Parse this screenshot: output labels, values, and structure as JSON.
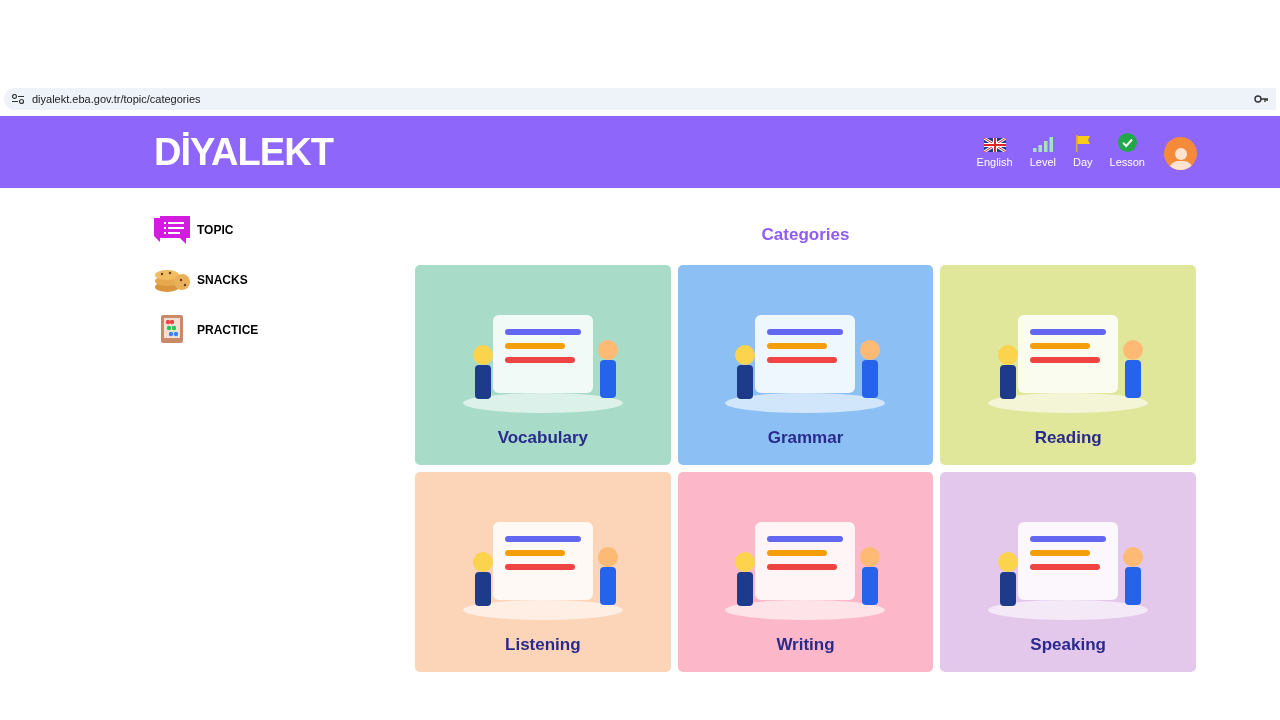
{
  "address_bar": {
    "url": "diyalekt.eba.gov.tr/topic/categories"
  },
  "header": {
    "logo": "DİYALEKT",
    "stats": [
      {
        "kind": "language",
        "label": "English"
      },
      {
        "kind": "level",
        "label": "Level"
      },
      {
        "kind": "day",
        "label": "Day"
      },
      {
        "kind": "lesson",
        "label": "Lesson"
      }
    ]
  },
  "sidebar": {
    "items": [
      {
        "kind": "topic",
        "label": "TOPIC"
      },
      {
        "kind": "snacks",
        "label": "SNACKS"
      },
      {
        "kind": "practice",
        "label": "PRACTICE"
      }
    ]
  },
  "main": {
    "title": "Categories",
    "cards": [
      {
        "label": "Vocabulary",
        "color": "#a8dcc8"
      },
      {
        "label": "Grammar",
        "color": "#8cc0f4"
      },
      {
        "label": "Reading",
        "color": "#e0e69a"
      },
      {
        "label": "Listening",
        "color": "#fcd4b8"
      },
      {
        "label": "Writing",
        "color": "#fcb8c8"
      },
      {
        "label": "Speaking",
        "color": "#e4c8ec"
      }
    ]
  }
}
